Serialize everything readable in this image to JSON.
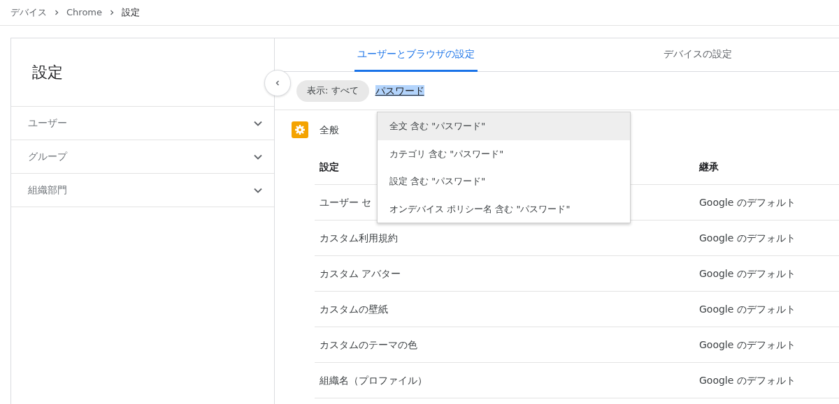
{
  "breadcrumb": [
    "デバイス",
    "Chrome",
    "設定"
  ],
  "sidebar": {
    "title": "設定",
    "items": [
      {
        "label": "ユーザー",
        "expanded": false
      },
      {
        "label": "グループ",
        "expanded": false
      },
      {
        "label": "組織部門",
        "expanded": false
      }
    ]
  },
  "tabs": [
    {
      "label": "ユーザーとブラウザの設定",
      "selected": true
    },
    {
      "label": "デバイスの設定",
      "selected": false
    }
  ],
  "filter": {
    "chip": "表示: すべて",
    "query": "パスワード"
  },
  "suggestions": [
    {
      "label": "全文 含む \"パスワード\"",
      "selected": true
    },
    {
      "label": "カテゴリ 含む \"パスワード\"",
      "selected": false
    },
    {
      "label": "設定 含む \"パスワード\"",
      "selected": false
    },
    {
      "label": "オンデバイス ポリシー名 含む \"パスワード\"",
      "selected": false
    }
  ],
  "section": {
    "title": "全般"
  },
  "table": {
    "columns": [
      "設定",
      "継承"
    ],
    "rows": [
      [
        "ユーザー セ",
        "Google のデフォルト"
      ],
      [
        "カスタム利用規約",
        "Google のデフォルト"
      ],
      [
        "カスタム アバター",
        "Google のデフォルト"
      ],
      [
        "カスタムの壁紙",
        "Google のデフォルト"
      ],
      [
        "カスタムのテーマの色",
        "Google のデフォルト"
      ],
      [
        "組織名（プロファイル）",
        "Google のデフォルト"
      ]
    ]
  }
}
